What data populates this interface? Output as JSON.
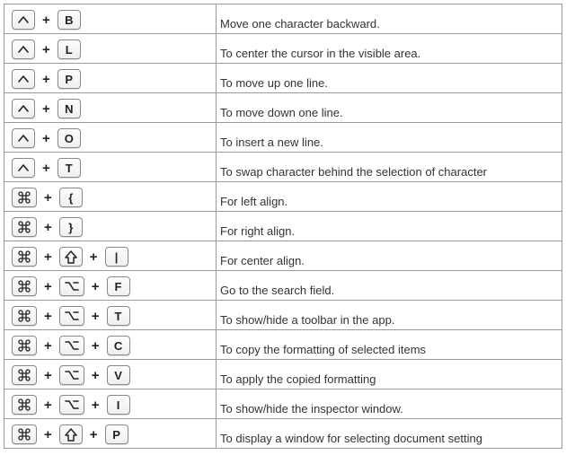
{
  "rows": [
    {
      "keys": [
        "ctrl",
        "B"
      ],
      "desc": "Move one character backward."
    },
    {
      "keys": [
        "ctrl",
        "L"
      ],
      "desc": "To center the cursor in the visible area."
    },
    {
      "keys": [
        "ctrl",
        "P"
      ],
      "desc": "To move up one line."
    },
    {
      "keys": [
        "ctrl",
        "N"
      ],
      "desc": "To move down one line."
    },
    {
      "keys": [
        "ctrl",
        "O"
      ],
      "desc": "To insert a new line."
    },
    {
      "keys": [
        "ctrl",
        "T"
      ],
      "desc": "To swap character behind the selection of character"
    },
    {
      "keys": [
        "cmd",
        "{"
      ],
      "desc": "For left align."
    },
    {
      "keys": [
        "cmd",
        "}"
      ],
      "desc": "For right align."
    },
    {
      "keys": [
        "cmd",
        "shift",
        "|"
      ],
      "desc": "For center align."
    },
    {
      "keys": [
        "cmd",
        "opt",
        "F"
      ],
      "desc": "Go to the search field."
    },
    {
      "keys": [
        "cmd",
        "opt",
        "T"
      ],
      "desc": "To show/hide a toolbar in the app."
    },
    {
      "keys": [
        "cmd",
        "opt",
        "C"
      ],
      "desc": "To copy the formatting of selected items"
    },
    {
      "keys": [
        "cmd",
        "opt",
        "V"
      ],
      "desc": "To apply the copied formatting"
    },
    {
      "keys": [
        "cmd",
        "opt",
        "I"
      ],
      "desc": "To show/hide the inspector window."
    },
    {
      "keys": [
        "cmd",
        "shift",
        "P"
      ],
      "desc": "To display a window for selecting document setting"
    }
  ],
  "plus": "+"
}
